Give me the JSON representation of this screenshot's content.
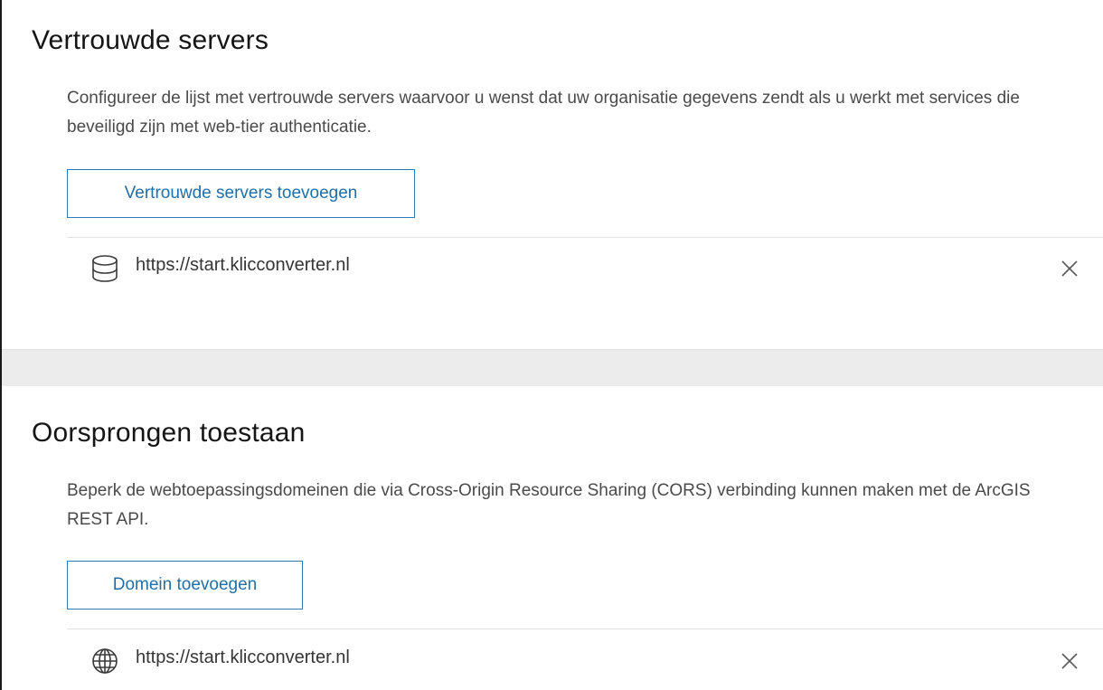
{
  "trusted_servers": {
    "title": "Vertrouwde servers",
    "description": "Configureer de lijst met vertrouwde servers waarvoor u wenst dat uw organisatie gegevens zendt als u werkt met services die beveiligd zijn met web-tier authenticatie.",
    "add_button_label": "Vertrouwde servers toevoegen",
    "items": [
      {
        "icon": "database-icon",
        "url": "https://start.klicconverter.nl"
      }
    ]
  },
  "allowed_origins": {
    "title": "Oorsprongen toestaan",
    "description": "Beperk de webtoepassingsdomeinen die via Cross-Origin Resource Sharing (CORS) verbinding kunnen maken met de ArcGIS REST API.",
    "add_button_label": "Domein toevoegen",
    "items": [
      {
        "icon": "globe-icon",
        "url": "https://start.klicconverter.nl"
      }
    ]
  },
  "colors": {
    "accent": "#2b7bb9",
    "page_background": "#ebebeb",
    "panel_background": "#ffffff"
  }
}
